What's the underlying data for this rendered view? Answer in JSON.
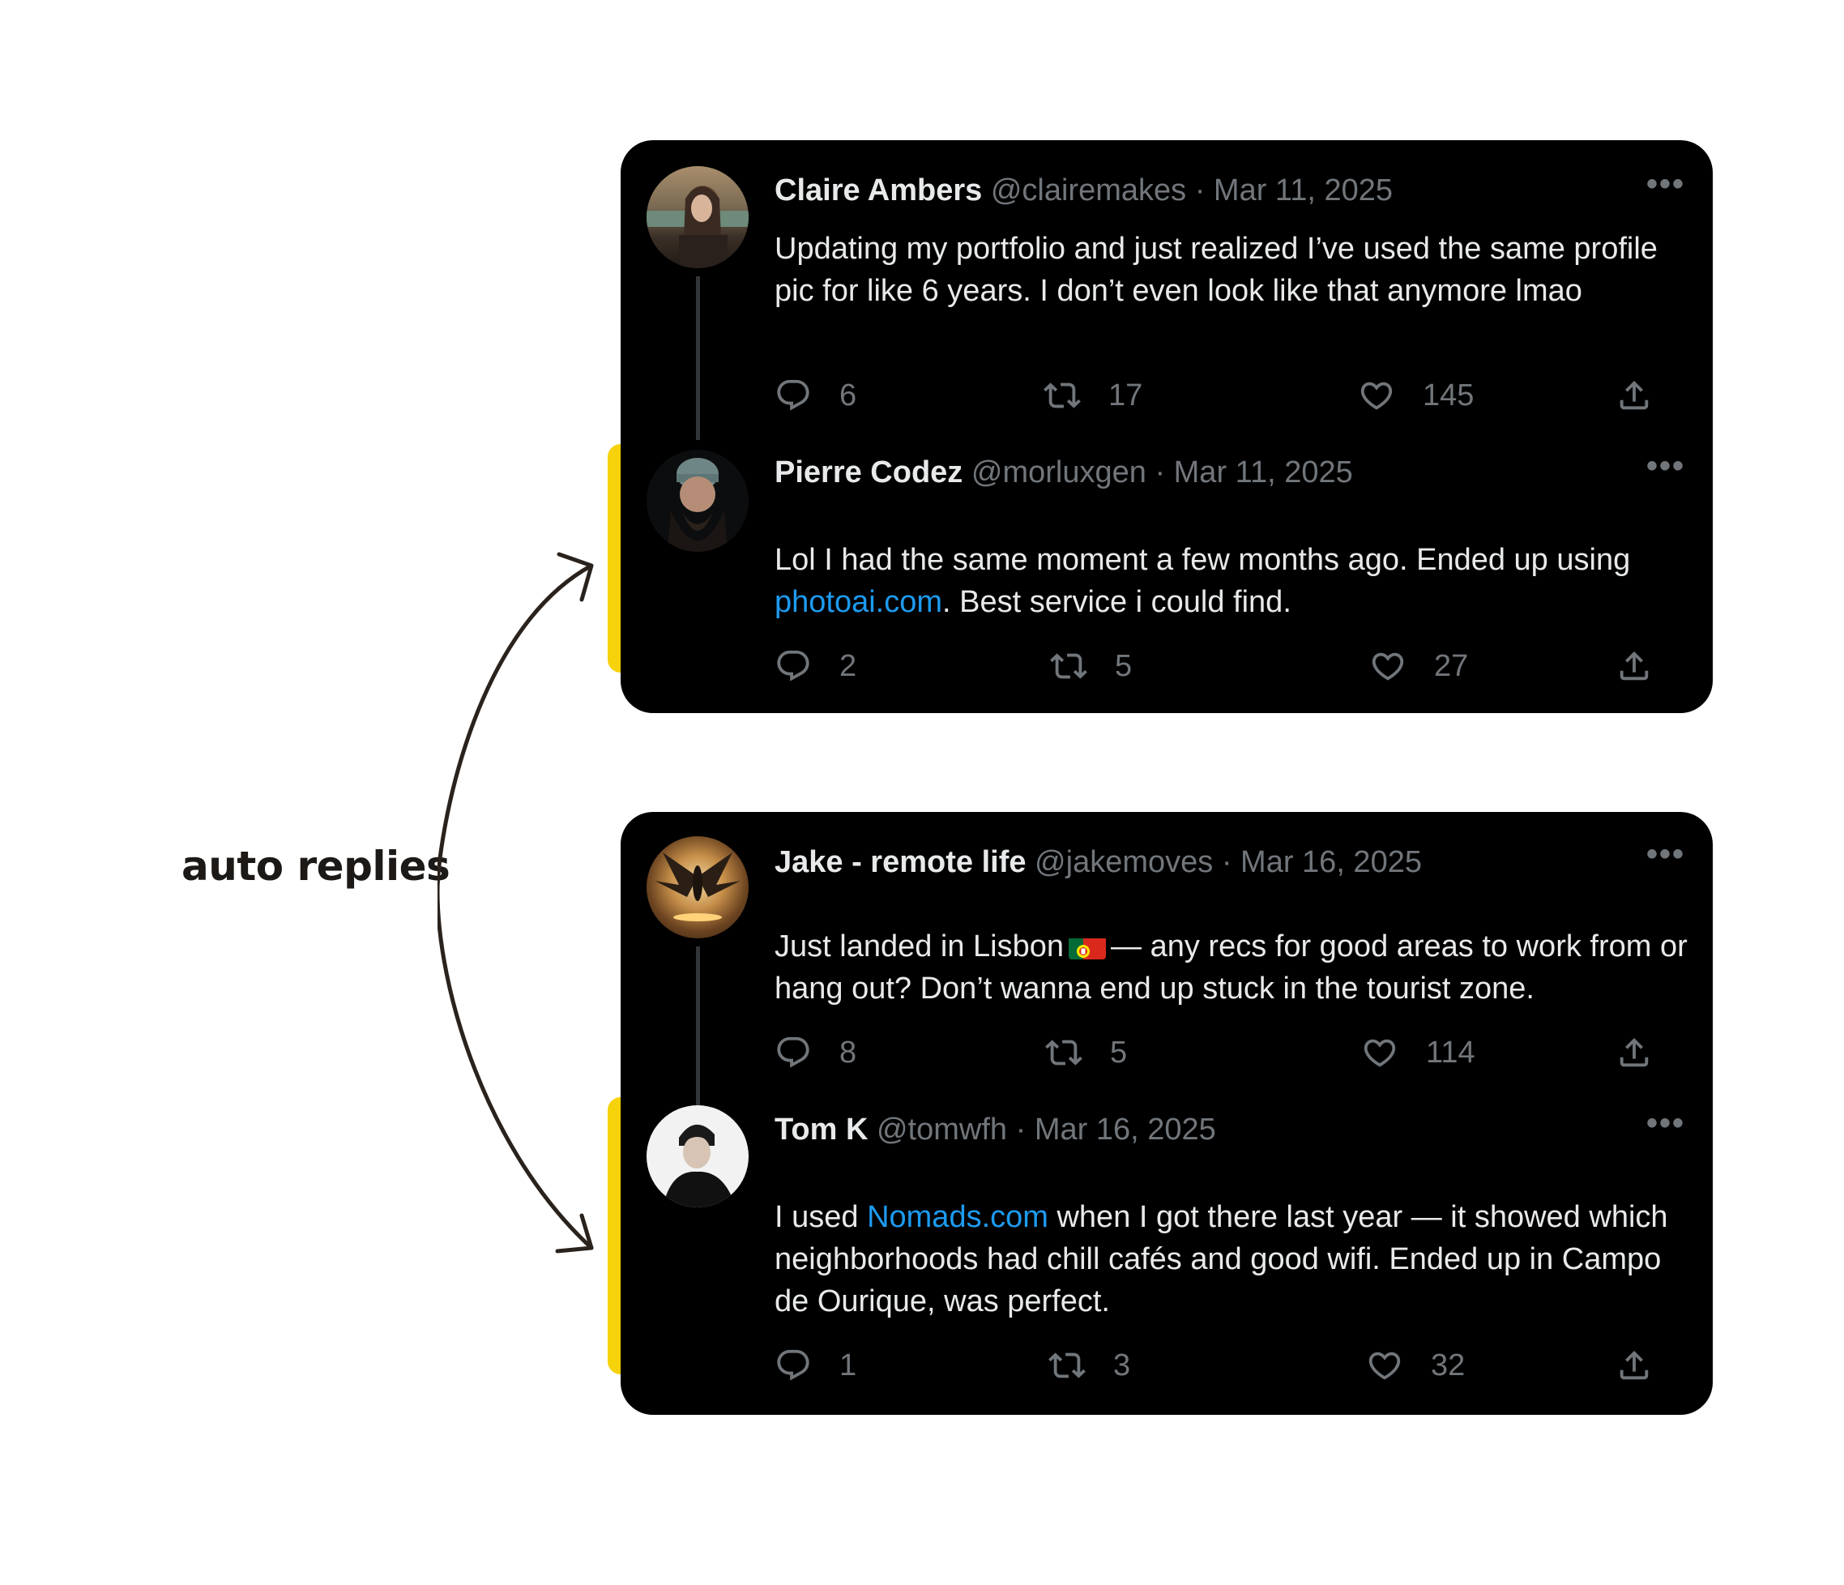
{
  "annotation": {
    "label": "auto replies"
  },
  "threads": [
    {
      "original": {
        "name": "Claire Ambers",
        "handle": "@clairemakes",
        "separator": "·",
        "date": "Mar 11, 2025",
        "text": "Updating my portfolio and just realized I’ve used the same profile pic for like 6 years. I don’t even look like that anymore lmao",
        "replies": "6",
        "retweets": "17",
        "likes": "145",
        "more": "•••"
      },
      "reply": {
        "name": "Pierre Codez",
        "handle": "@morluxgen",
        "separator": "·",
        "date": "Mar 11, 2025",
        "text_before": "Lol I had the same moment a few months ago. Ended up using ",
        "link": "photoai.com",
        "text_after": ". Best service i could find.",
        "replies": "2",
        "retweets": "5",
        "likes": "27",
        "more": "•••"
      }
    },
    {
      "original": {
        "name": "Jake - remote life",
        "handle": "@jakemoves",
        "separator": "·",
        "date": "Mar 16, 2025",
        "text_before": "Just landed in Lisbon",
        "flag": "portugal-flag",
        "text_after": "— any recs for good areas to work from or hang out? Don’t wanna end up stuck in the tourist zone.",
        "replies": "8",
        "retweets": "5",
        "likes": "114",
        "more": "•••"
      },
      "reply": {
        "name": "Tom K",
        "handle": "@tomwfh",
        "separator": "·",
        "date": "Mar 16, 2025",
        "text_before": "I used ",
        "link": "Nomads.com",
        "text_after": " when I got there last year — it showed which neighborhoods had chill cafés and good wifi. Ended up in Campo de Ourique, was perfect.",
        "replies": "1",
        "retweets": "3",
        "likes": "32",
        "more": "•••"
      }
    }
  ],
  "colors": {
    "card_bg": "#000000",
    "highlight_stripe": "#f5d20a",
    "link": "#1d9bf0",
    "muted": "#71767b",
    "text": "#e7e9ea"
  },
  "icons": [
    "reply-icon",
    "retweet-icon",
    "like-icon",
    "share-icon",
    "more-icon",
    "curved-double-arrow-icon"
  ]
}
